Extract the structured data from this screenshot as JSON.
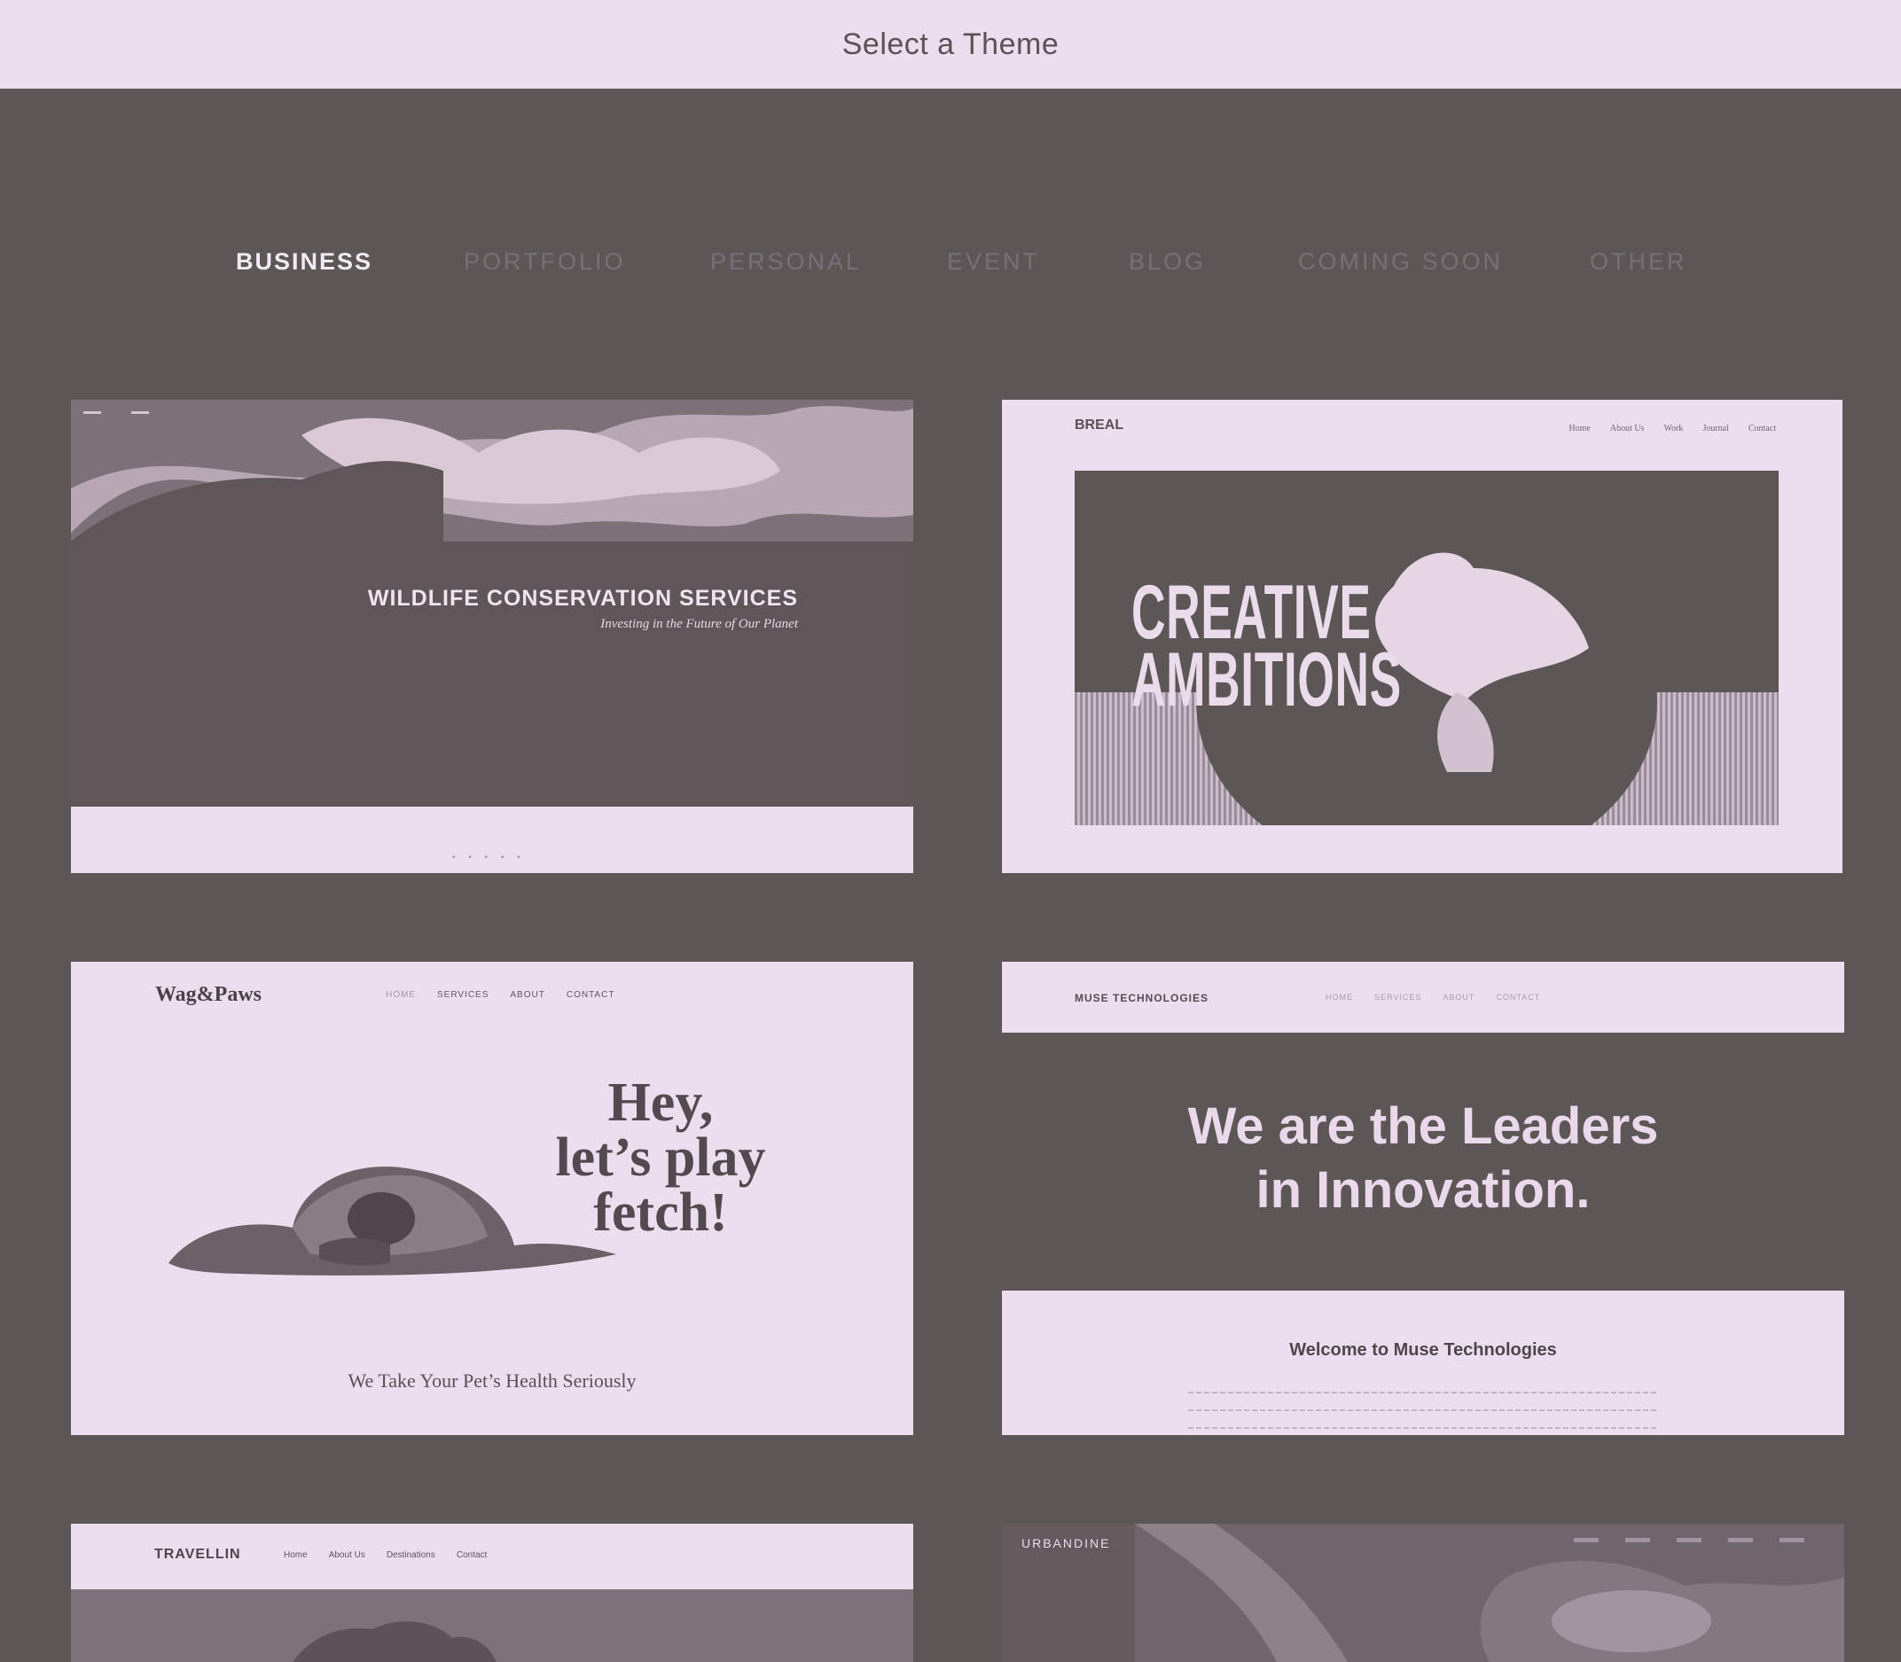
{
  "header": {
    "title": "Select a Theme"
  },
  "tabs": [
    {
      "label": "BUSINESS",
      "active": true
    },
    {
      "label": "PORTFOLIO",
      "active": false
    },
    {
      "label": "PERSONAL",
      "active": false
    },
    {
      "label": "EVENT",
      "active": false
    },
    {
      "label": "BLOG",
      "active": false
    },
    {
      "label": "COMING SOON",
      "active": false
    },
    {
      "label": "OTHER",
      "active": false
    }
  ],
  "themes": [
    {
      "headline": "WILDLIFE CONSERVATION SERVICES",
      "subheadline": "Investing in the Future of Our Planet"
    },
    {
      "logo": "BREAL",
      "nav": [
        "Home",
        "About Us",
        "Work",
        "Journal",
        "Contact"
      ],
      "headline_line1": "CREATIVE",
      "headline_line2": "AMBITIONS"
    },
    {
      "logo": "Wag&Paws",
      "nav": [
        "HOME",
        "SERVICES",
        "ABOUT",
        "CONTACT"
      ],
      "headline_line1": "Hey,",
      "headline_line2": "let’s play",
      "headline_line3": "fetch!",
      "tagline": "We Take Your Pet’s Health Seriously"
    },
    {
      "logo": "MUSE TECHNOLOGIES",
      "nav": [
        "HOME",
        "SERVICES",
        "ABOUT",
        "CONTACT"
      ],
      "headline_line1": "We are the Leaders",
      "headline_line2": "in Innovation.",
      "welcome": "Welcome to Muse Technologies"
    },
    {
      "logo": "TRAVELLIN",
      "nav": [
        "Home",
        "About Us",
        "Destinations",
        "Contact"
      ]
    },
    {
      "logo": "URBANDINE"
    }
  ],
  "colors": {
    "background": "#5d5656",
    "pale": "#ecdeee",
    "active_tab": "#f3e9f3",
    "inactive_tab": "#7a6f79"
  }
}
